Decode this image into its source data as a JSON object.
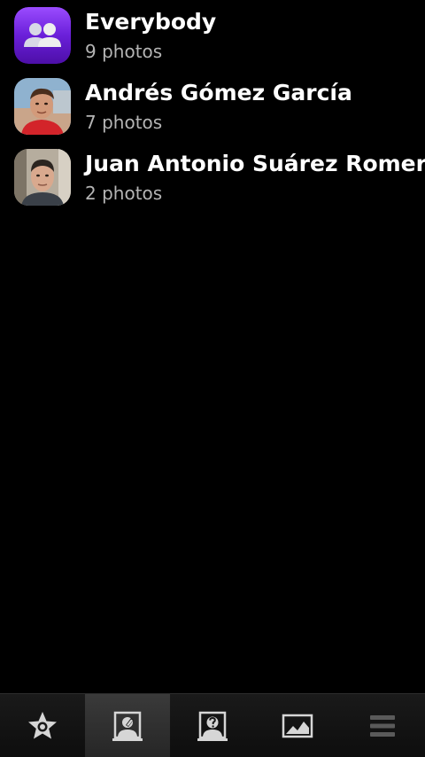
{
  "people": [
    {
      "name": "Everybody",
      "count": "9 photos",
      "avatar": "group-icon",
      "color": "#6a1fc9"
    },
    {
      "name": "Andrés Gómez García",
      "count": "7 photos",
      "avatar": "person-photo"
    },
    {
      "name": "Juan Antonio Suárez Romero",
      "count": "2 photos",
      "avatar": "person-photo"
    }
  ],
  "toolbar": {
    "buttons": [
      {
        "icon": "favorites-star-icon",
        "active": false
      },
      {
        "icon": "tagged-people-icon",
        "active": true
      },
      {
        "icon": "unknown-people-icon",
        "active": false
      },
      {
        "icon": "pictures-icon",
        "active": false
      },
      {
        "icon": "menu-icon",
        "active": false
      }
    ]
  }
}
